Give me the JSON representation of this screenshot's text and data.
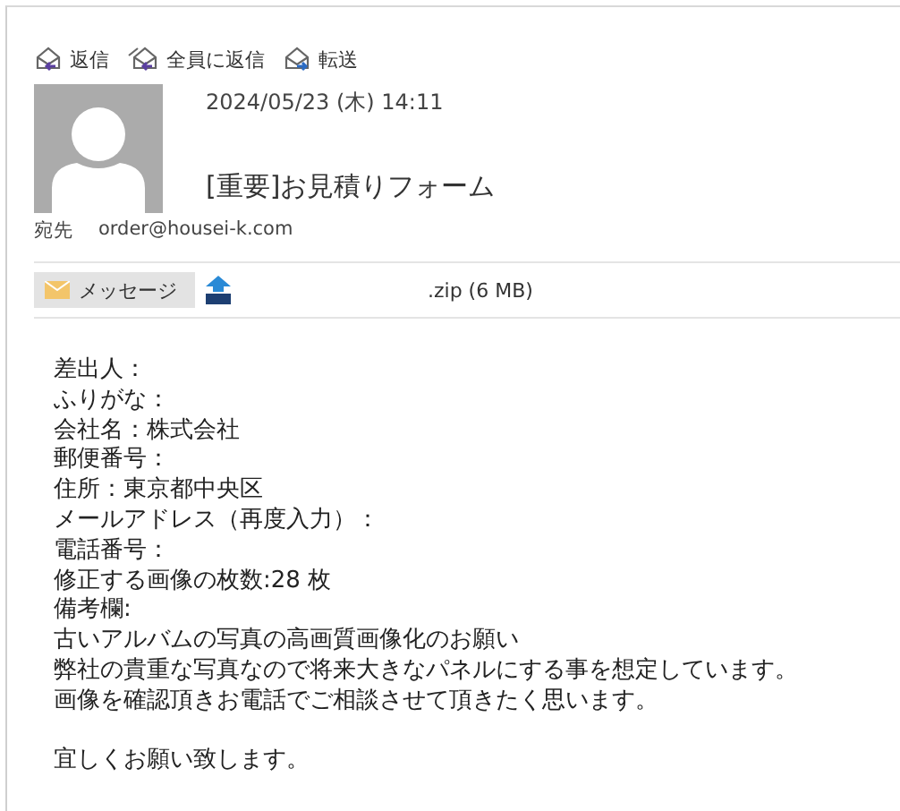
{
  "actions": [
    {
      "kind": "reply",
      "label": "返信"
    },
    {
      "kind": "reply_all",
      "label": "全員に返信"
    },
    {
      "kind": "forward",
      "label": "転送"
    }
  ],
  "message": {
    "date": "2024/05/23 (木) 14:11",
    "subject": "[重要]お見積りフォーム",
    "to_label": "宛先",
    "to": "order@housei-k.com"
  },
  "attachments": [
    {
      "kind": "message",
      "label": "メッセージ",
      "selected": true
    },
    {
      "kind": "zip",
      "label": ".zip (6 MB)",
      "selected": false
    }
  ],
  "body": [
    "差出人：",
    "ふりがな：",
    "会社名：株式会社",
    "郵便番号：",
    "住所：東京都中央区",
    "メールアドレス（再度入力）：",
    "電話番号：",
    "修正する画像の枚数:28 枚",
    "備考欄:",
    "古いアルバムの写真の高画質画像化のお願い",
    "弊社の貴重な写真なので将来大きなパネルにする事を想定しています。",
    "画像を確認頂きお電話でご相談させて頂きたく思います。"
  ],
  "closing": "宜しくお願い致します。"
}
